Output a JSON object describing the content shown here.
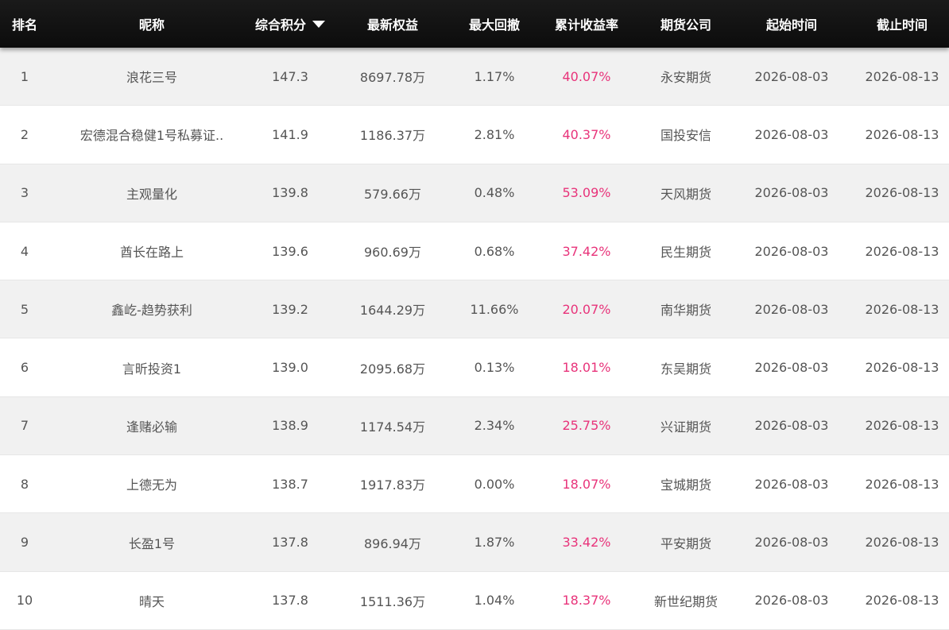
{
  "header": {
    "rank": "排名",
    "name": "昵称",
    "score": "综合积分",
    "equity": "最新权益",
    "drawdown": "最大回撤",
    "return": "累计收益率",
    "company": "期货公司",
    "start": "起始时间",
    "end": "截止时间",
    "sort_icon": "caret-down-icon"
  },
  "colors": {
    "return_text": "#e8337a",
    "header_bg": "#111111"
  },
  "rows": [
    {
      "rank": "1",
      "name": "浪花三号",
      "score": "147.3",
      "equity": "8697.78万",
      "drawdown": "1.17%",
      "return": "40.07%",
      "company": "永安期货",
      "start": "2026-08-03",
      "end": "2026-08-13"
    },
    {
      "rank": "2",
      "name": "宏德混合稳健1号私募证..",
      "score": "141.9",
      "equity": "1186.37万",
      "drawdown": "2.81%",
      "return": "40.37%",
      "company": "国投安信",
      "start": "2026-08-03",
      "end": "2026-08-13"
    },
    {
      "rank": "3",
      "name": "主观量化",
      "score": "139.8",
      "equity": "579.66万",
      "drawdown": "0.48%",
      "return": "53.09%",
      "company": "天风期货",
      "start": "2026-08-03",
      "end": "2026-08-13"
    },
    {
      "rank": "4",
      "name": "酋长在路上",
      "score": "139.6",
      "equity": "960.69万",
      "drawdown": "0.68%",
      "return": "37.42%",
      "company": "民生期货",
      "start": "2026-08-03",
      "end": "2026-08-13"
    },
    {
      "rank": "5",
      "name": "鑫屹-趋势获利",
      "score": "139.2",
      "equity": "1644.29万",
      "drawdown": "11.66%",
      "return": "20.07%",
      "company": "南华期货",
      "start": "2026-08-03",
      "end": "2026-08-13"
    },
    {
      "rank": "6",
      "name": "言昕投资1",
      "score": "139.0",
      "equity": "2095.68万",
      "drawdown": "0.13%",
      "return": "18.01%",
      "company": "东吴期货",
      "start": "2026-08-03",
      "end": "2026-08-13"
    },
    {
      "rank": "7",
      "name": "逢赌必输",
      "score": "138.9",
      "equity": "1174.54万",
      "drawdown": "2.34%",
      "return": "25.75%",
      "company": "兴证期货",
      "start": "2026-08-03",
      "end": "2026-08-13"
    },
    {
      "rank": "8",
      "name": "上德无为",
      "score": "138.7",
      "equity": "1917.83万",
      "drawdown": "0.00%",
      "return": "18.07%",
      "company": "宝城期货",
      "start": "2026-08-03",
      "end": "2026-08-13"
    },
    {
      "rank": "9",
      "name": "长盈1号",
      "score": "137.8",
      "equity": "896.94万",
      "drawdown": "1.87%",
      "return": "33.42%",
      "company": "平安期货",
      "start": "2026-08-03",
      "end": "2026-08-13"
    },
    {
      "rank": "10",
      "name": "晴天",
      "score": "137.8",
      "equity": "1511.36万",
      "drawdown": "1.04%",
      "return": "18.37%",
      "company": "新世纪期货",
      "start": "2026-08-03",
      "end": "2026-08-13"
    }
  ]
}
